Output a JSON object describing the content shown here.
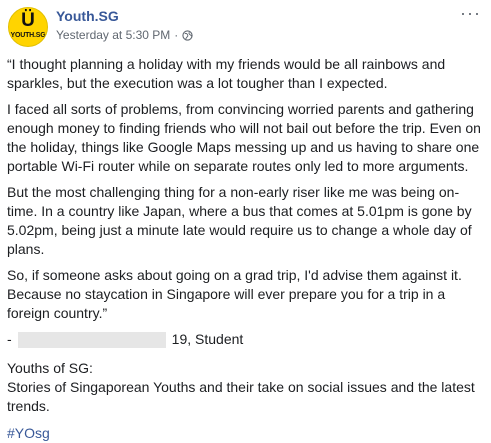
{
  "header": {
    "page_name": "Youth.SG",
    "avatar_symbol": "Ü",
    "avatar_text": "YOUTH.SG",
    "timestamp": "Yesterday at 5:30 PM",
    "separator": "·",
    "privacy_icon": "globe-icon",
    "more_label": "···"
  },
  "post": {
    "paragraphs": [
      "“I thought planning a holiday with my friends would be all rainbows and sparkles, but the execution was a lot tougher than I expected.",
      "I faced all sorts of problems, from convincing worried parents and gathering enough money to finding friends who will not bail out before the trip. Even on the holiday, things like Google Maps messing up and us having to share one portable Wi-Fi router while on separate routes only led to more arguments.",
      "But the most challenging thing for a non-early riser like me was being on-time. In a country like Japan, where a bus that comes at 5.01pm is gone by 5.02pm, being just a minute late would require us to change a whole day of plans.",
      "So, if someone asks about going on a grad trip, I'd advise them against it. Because no staycation in Singapore will ever prepare you for a trip in a foreign country.”"
    ],
    "attribution_dash": "-",
    "attribution": "19, Student",
    "footer_title": "Youths of SG:",
    "footer_text": "Stories of Singaporean Youths and their take on social issues and the latest trends.",
    "hashtag": "#YOsg"
  },
  "colors": {
    "link": "#385898",
    "meta": "#606770",
    "avatar_bg": "#ffd400"
  }
}
